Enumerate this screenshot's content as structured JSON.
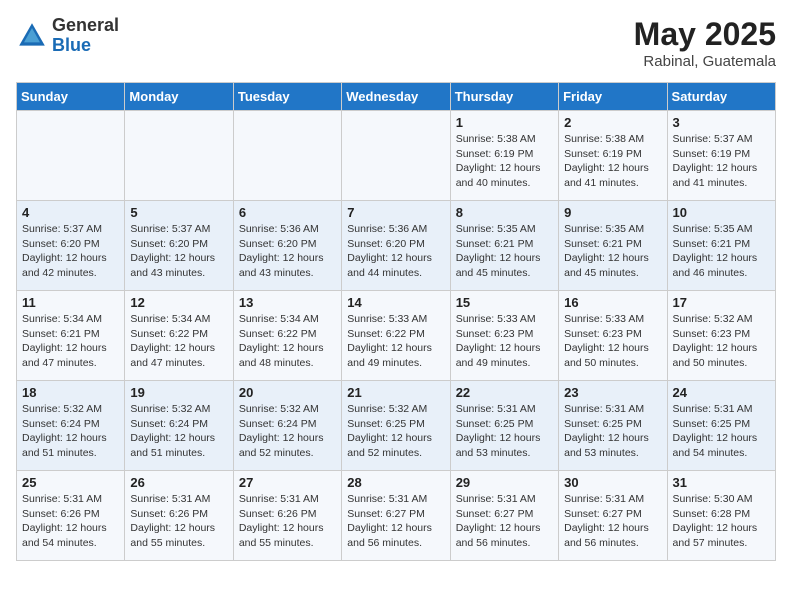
{
  "header": {
    "logo_general": "General",
    "logo_blue": "Blue",
    "month_year": "May 2025",
    "location": "Rabinal, Guatemala"
  },
  "days_of_week": [
    "Sunday",
    "Monday",
    "Tuesday",
    "Wednesday",
    "Thursday",
    "Friday",
    "Saturday"
  ],
  "weeks": [
    [
      {
        "day": "",
        "info": ""
      },
      {
        "day": "",
        "info": ""
      },
      {
        "day": "",
        "info": ""
      },
      {
        "day": "",
        "info": ""
      },
      {
        "day": "1",
        "info": "Sunrise: 5:38 AM\nSunset: 6:19 PM\nDaylight: 12 hours\nand 40 minutes."
      },
      {
        "day": "2",
        "info": "Sunrise: 5:38 AM\nSunset: 6:19 PM\nDaylight: 12 hours\nand 41 minutes."
      },
      {
        "day": "3",
        "info": "Sunrise: 5:37 AM\nSunset: 6:19 PM\nDaylight: 12 hours\nand 41 minutes."
      }
    ],
    [
      {
        "day": "4",
        "info": "Sunrise: 5:37 AM\nSunset: 6:20 PM\nDaylight: 12 hours\nand 42 minutes."
      },
      {
        "day": "5",
        "info": "Sunrise: 5:37 AM\nSunset: 6:20 PM\nDaylight: 12 hours\nand 43 minutes."
      },
      {
        "day": "6",
        "info": "Sunrise: 5:36 AM\nSunset: 6:20 PM\nDaylight: 12 hours\nand 43 minutes."
      },
      {
        "day": "7",
        "info": "Sunrise: 5:36 AM\nSunset: 6:20 PM\nDaylight: 12 hours\nand 44 minutes."
      },
      {
        "day": "8",
        "info": "Sunrise: 5:35 AM\nSunset: 6:21 PM\nDaylight: 12 hours\nand 45 minutes."
      },
      {
        "day": "9",
        "info": "Sunrise: 5:35 AM\nSunset: 6:21 PM\nDaylight: 12 hours\nand 45 minutes."
      },
      {
        "day": "10",
        "info": "Sunrise: 5:35 AM\nSunset: 6:21 PM\nDaylight: 12 hours\nand 46 minutes."
      }
    ],
    [
      {
        "day": "11",
        "info": "Sunrise: 5:34 AM\nSunset: 6:21 PM\nDaylight: 12 hours\nand 47 minutes."
      },
      {
        "day": "12",
        "info": "Sunrise: 5:34 AM\nSunset: 6:22 PM\nDaylight: 12 hours\nand 47 minutes."
      },
      {
        "day": "13",
        "info": "Sunrise: 5:34 AM\nSunset: 6:22 PM\nDaylight: 12 hours\nand 48 minutes."
      },
      {
        "day": "14",
        "info": "Sunrise: 5:33 AM\nSunset: 6:22 PM\nDaylight: 12 hours\nand 49 minutes."
      },
      {
        "day": "15",
        "info": "Sunrise: 5:33 AM\nSunset: 6:23 PM\nDaylight: 12 hours\nand 49 minutes."
      },
      {
        "day": "16",
        "info": "Sunrise: 5:33 AM\nSunset: 6:23 PM\nDaylight: 12 hours\nand 50 minutes."
      },
      {
        "day": "17",
        "info": "Sunrise: 5:32 AM\nSunset: 6:23 PM\nDaylight: 12 hours\nand 50 minutes."
      }
    ],
    [
      {
        "day": "18",
        "info": "Sunrise: 5:32 AM\nSunset: 6:24 PM\nDaylight: 12 hours\nand 51 minutes."
      },
      {
        "day": "19",
        "info": "Sunrise: 5:32 AM\nSunset: 6:24 PM\nDaylight: 12 hours\nand 51 minutes."
      },
      {
        "day": "20",
        "info": "Sunrise: 5:32 AM\nSunset: 6:24 PM\nDaylight: 12 hours\nand 52 minutes."
      },
      {
        "day": "21",
        "info": "Sunrise: 5:32 AM\nSunset: 6:25 PM\nDaylight: 12 hours\nand 52 minutes."
      },
      {
        "day": "22",
        "info": "Sunrise: 5:31 AM\nSunset: 6:25 PM\nDaylight: 12 hours\nand 53 minutes."
      },
      {
        "day": "23",
        "info": "Sunrise: 5:31 AM\nSunset: 6:25 PM\nDaylight: 12 hours\nand 53 minutes."
      },
      {
        "day": "24",
        "info": "Sunrise: 5:31 AM\nSunset: 6:25 PM\nDaylight: 12 hours\nand 54 minutes."
      }
    ],
    [
      {
        "day": "25",
        "info": "Sunrise: 5:31 AM\nSunset: 6:26 PM\nDaylight: 12 hours\nand 54 minutes."
      },
      {
        "day": "26",
        "info": "Sunrise: 5:31 AM\nSunset: 6:26 PM\nDaylight: 12 hours\nand 55 minutes."
      },
      {
        "day": "27",
        "info": "Sunrise: 5:31 AM\nSunset: 6:26 PM\nDaylight: 12 hours\nand 55 minutes."
      },
      {
        "day": "28",
        "info": "Sunrise: 5:31 AM\nSunset: 6:27 PM\nDaylight: 12 hours\nand 56 minutes."
      },
      {
        "day": "29",
        "info": "Sunrise: 5:31 AM\nSunset: 6:27 PM\nDaylight: 12 hours\nand 56 minutes."
      },
      {
        "day": "30",
        "info": "Sunrise: 5:31 AM\nSunset: 6:27 PM\nDaylight: 12 hours\nand 56 minutes."
      },
      {
        "day": "31",
        "info": "Sunrise: 5:30 AM\nSunset: 6:28 PM\nDaylight: 12 hours\nand 57 minutes."
      }
    ]
  ]
}
